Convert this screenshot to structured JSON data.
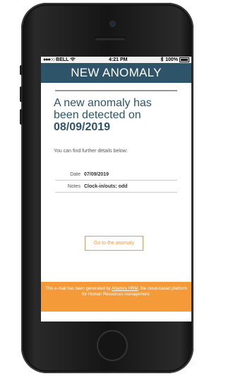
{
  "status_bar": {
    "signal": "●●●○○",
    "carrier": "BELL",
    "time": "4:21 PM",
    "battery": "100%"
  },
  "header": {
    "title": "NEW ANOMALY"
  },
  "message": {
    "headline_line1": "A new anomaly has",
    "headline_line2": "been detected on",
    "headline_date": "08/09/2019",
    "subtext": "You can find further details below:"
  },
  "details": [
    {
      "label": "Date",
      "value": "07/09/2019"
    },
    {
      "label": "Notes",
      "value": "Clock-in/outs: odd"
    }
  ],
  "action": {
    "button_label": "Go to the anomaly"
  },
  "footer": {
    "pre": "This e-mail has been generated by ",
    "link": "Altamira HRM",
    "post": ", the cloud-based platform for Human Resources management."
  },
  "colors": {
    "header_bg": "#2d5468",
    "accent": "#f59a38"
  }
}
